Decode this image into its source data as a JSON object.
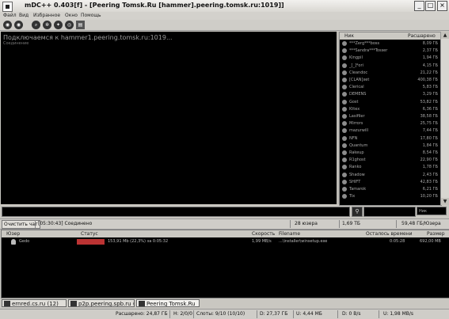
{
  "window": {
    "title": "mDC++ 0.403[f] - [Peering Tomsk.Ru [hammer].peering.tomsk.ru:1019]]",
    "minimize": "_",
    "maximize": "□",
    "close": "×"
  },
  "menu": [
    "Файл",
    "Вид",
    "Избранное",
    "Окно",
    "Помощь"
  ],
  "chat": {
    "lines": [
      "Подключаемся к hammer1.peering.tomsk.ru:1019...",
      "Соединение"
    ]
  },
  "userlist": {
    "columns": {
      "nick": "Ник",
      "share": "Расшарено"
    },
    "rows": [
      {
        "nick": "***Zerg***boss",
        "share": "8,09 ГБ"
      },
      {
        "nick": "***Sandra***Tosser",
        "share": "2,37 ГБ"
      },
      {
        "nick": "Kingpil",
        "share": "1,94 ГБ"
      },
      {
        "nick": "_[_]*ori",
        "share": "4,15 ГБ"
      },
      {
        "nick": "Cleandoc",
        "share": "21,22 ГБ"
      },
      {
        "nick": "[CLAN]xet",
        "share": "400,38 ГБ"
      },
      {
        "nick": "Clerical",
        "share": "5,83 ГБ"
      },
      {
        "nick": "DEMENS",
        "share": "3,29 ГБ"
      },
      {
        "nick": "Gost",
        "share": "53,82 ГБ"
      },
      {
        "nick": "Kttex",
        "share": "6,36 ГБ"
      },
      {
        "nick": "Lasifiler",
        "share": "38,58 ГБ"
      },
      {
        "nick": "Mirrors",
        "share": "25,75 ГБ"
      },
      {
        "nick": "mazurwill",
        "share": "7,44 ГБ"
      },
      {
        "nick": "NFN",
        "share": "17,80 ГБ"
      },
      {
        "nick": "Quantum",
        "share": "1,84 ГБ"
      },
      {
        "nick": "Rakeup",
        "share": "8,54 ГБ"
      },
      {
        "nick": "R1ghost",
        "share": "22,90 ГБ"
      },
      {
        "nick": "Ranko",
        "share": "1,78 ГБ"
      },
      {
        "nick": "Shadow",
        "share": "2,43 ГБ"
      },
      {
        "nick": "SHIFT",
        "share": "42,83 ГБ"
      },
      {
        "nick": "Tamarok",
        "share": "6,21 ГБ"
      },
      {
        "nick": "Tix",
        "share": "10,20 ГБ"
      }
    ]
  },
  "filter": {
    "select_value": "Ник"
  },
  "status": {
    "clear_button": "Очистить чат",
    "time_msg": "[05:30:43] Соединено",
    "users_count": "28 юзера",
    "shared_mid": "1,69 ТБ",
    "shared_total": "59,48 ГБ/Юзера"
  },
  "transfers": {
    "columns": [
      "Юзер",
      "Статус",
      "Скорость",
      "Filename",
      "Осталось времени",
      "Размер"
    ],
    "rows": [
      {
        "user": "Gedo",
        "status": "153,91 Mb (22,3%) за 0:05:32",
        "speed": "1,99 MB/s",
        "file": "...\\installer\\winsetup.exe",
        "time_left": "0:05:28",
        "size": "692,00 MB"
      }
    ]
  },
  "tabs": [
    {
      "label": "ernred.cs.ru (12)"
    },
    {
      "label": "p2p.peering.spb.ru (2)"
    },
    {
      "label": "Peering Tomsk.Ru"
    }
  ],
  "bottom": {
    "shared": "Расшарено: 24,87 ГБ",
    "hubs": "H: 2/0/0",
    "slots": "Слоты: 9/10 (10/10)",
    "down": "D: 27,37 ГБ",
    "up": "U: 4,44 МБ",
    "down_speed": "D: 0 B/s",
    "up_speed": "U: 1,98 MB/s"
  },
  "colors": {
    "accent": "#b33333",
    "background": "#000000"
  }
}
